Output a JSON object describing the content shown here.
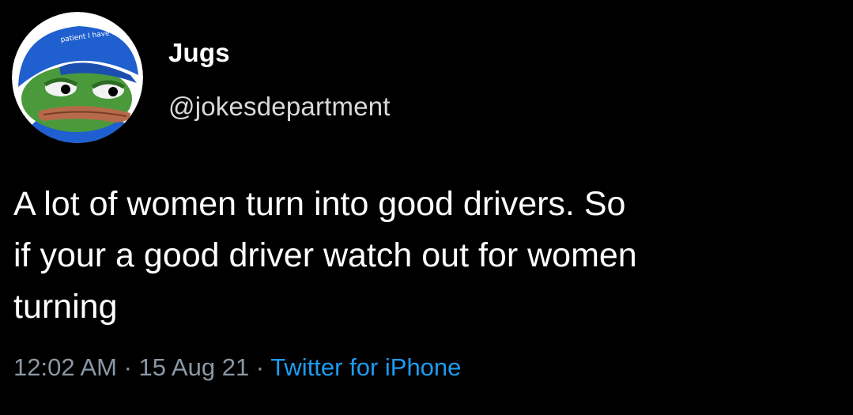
{
  "tweet": {
    "author": {
      "display_name": "Jugs",
      "handle": "@jokesdepartment",
      "avatar_icon": "pepe-frog-blue-cap-avatar",
      "avatar_cap_text": "patient I have autism"
    },
    "text": "A lot of women turn into good drivers. So\nif your a good driver watch out for women\nturning",
    "time": "12:02 AM",
    "separator": " · ",
    "date": "15 Aug 21",
    "source": "Twitter for iPhone"
  },
  "colors": {
    "background": "#000000",
    "primary_text": "#ffffff",
    "secondary_text": "#8b98a5",
    "link": "#1d9bf0",
    "cap_blue": "#1f5fcf",
    "frog_green": "#4a9a3c"
  }
}
